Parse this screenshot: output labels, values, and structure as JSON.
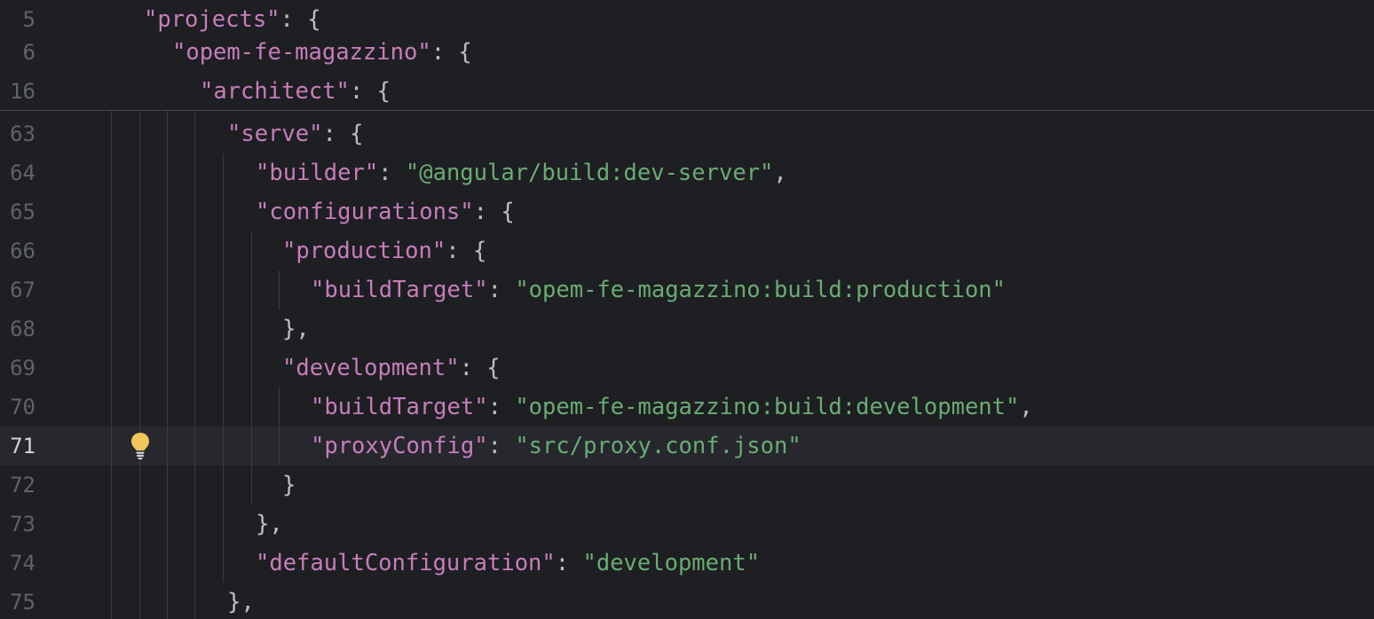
{
  "editor": {
    "sticky_lines": [
      {
        "num": "5",
        "tokens": [
          {
            "t": "\"projects\"",
            "c": "k"
          },
          {
            "t": ": {",
            "c": "p"
          }
        ]
      },
      {
        "num": "6",
        "tokens": [
          {
            "t": "\"opem-fe-magazzino\"",
            "c": "k"
          },
          {
            "t": ": {",
            "c": "p"
          }
        ]
      },
      {
        "num": "16",
        "tokens": [
          {
            "t": "\"architect\"",
            "c": "k"
          },
          {
            "t": ": {",
            "c": "p"
          }
        ]
      }
    ],
    "lines": [
      {
        "num": "63",
        "tokens": [
          {
            "t": "\"serve\"",
            "c": "k"
          },
          {
            "t": ": {",
            "c": "p"
          }
        ]
      },
      {
        "num": "64",
        "tokens": [
          {
            "t": "\"builder\"",
            "c": "k"
          },
          {
            "t": ": ",
            "c": "p"
          },
          {
            "t": "\"@angular/build:dev-server\"",
            "c": "s"
          },
          {
            "t": ",",
            "c": "p"
          }
        ]
      },
      {
        "num": "65",
        "tokens": [
          {
            "t": "\"configurations\"",
            "c": "k"
          },
          {
            "t": ": {",
            "c": "p"
          }
        ]
      },
      {
        "num": "66",
        "tokens": [
          {
            "t": "\"production\"",
            "c": "k"
          },
          {
            "t": ": {",
            "c": "p"
          }
        ]
      },
      {
        "num": "67",
        "tokens": [
          {
            "t": "\"buildTarget\"",
            "c": "k"
          },
          {
            "t": ": ",
            "c": "p"
          },
          {
            "t": "\"opem-fe-magazzino:build:production\"",
            "c": "s"
          }
        ]
      },
      {
        "num": "68",
        "tokens": [
          {
            "t": "},",
            "c": "p"
          }
        ]
      },
      {
        "num": "69",
        "tokens": [
          {
            "t": "\"development\"",
            "c": "k"
          },
          {
            "t": ": {",
            "c": "p"
          }
        ]
      },
      {
        "num": "70",
        "tokens": [
          {
            "t": "\"buildTarget\"",
            "c": "k"
          },
          {
            "t": ": ",
            "c": "p"
          },
          {
            "t": "\"opem-fe-magazzino:build:development\"",
            "c": "s"
          },
          {
            "t": ",",
            "c": "p"
          }
        ]
      },
      {
        "num": "71",
        "current": true,
        "tokens": [
          {
            "t": "\"proxyConfig\"",
            "c": "k"
          },
          {
            "t": ": ",
            "c": "p"
          },
          {
            "t": "\"src/proxy.conf.json\"",
            "c": "s"
          }
        ]
      },
      {
        "num": "72",
        "tokens": [
          {
            "t": "}",
            "c": "p"
          }
        ]
      },
      {
        "num": "73",
        "tokens": [
          {
            "t": "},",
            "c": "p"
          }
        ]
      },
      {
        "num": "74",
        "tokens": [
          {
            "t": "\"defaultConfiguration\"",
            "c": "k"
          },
          {
            "t": ": ",
            "c": "p"
          },
          {
            "t": "\"development\"",
            "c": "s"
          }
        ]
      },
      {
        "num": "75",
        "tokens": [
          {
            "t": "},",
            "c": "p"
          }
        ]
      }
    ],
    "intention_icon": "lightbulb-icon",
    "colors": {
      "background": "#1e1f22",
      "current_line": "#26282e",
      "json_key": "#c77dbb",
      "json_string": "#6aab73",
      "punctuation": "#bcbec4",
      "line_number": "#5f6266",
      "line_number_current": "#d1d3d8",
      "bulb": "#f2c55c"
    }
  }
}
